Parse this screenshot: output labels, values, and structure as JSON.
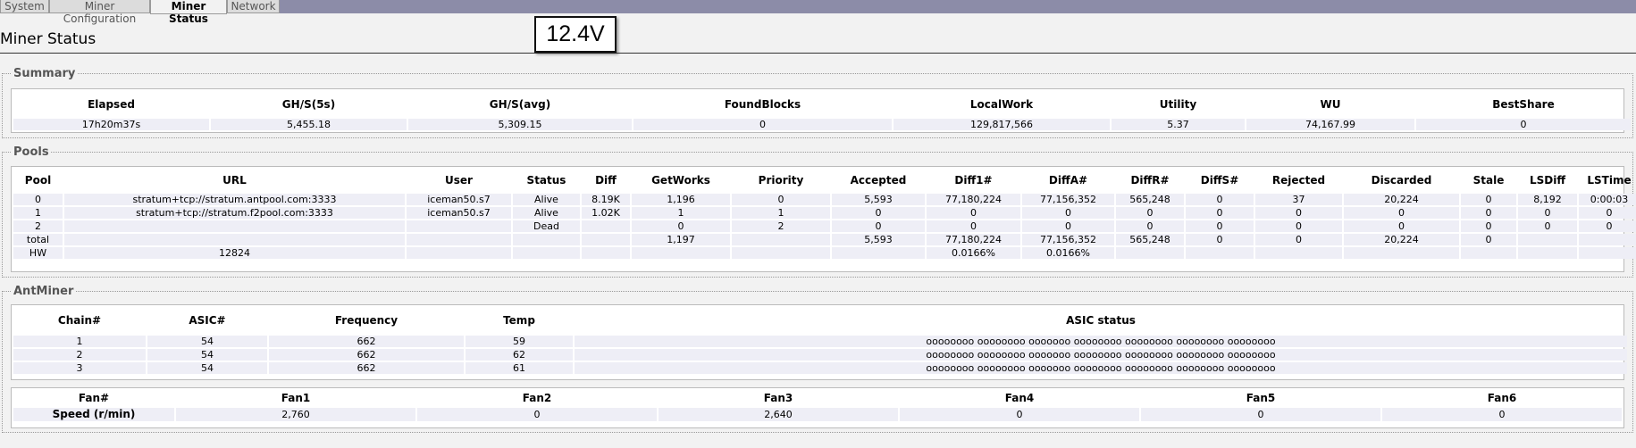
{
  "tabs": [
    {
      "label": "System"
    },
    {
      "label": "Miner Configuration"
    },
    {
      "label": "Miner Status",
      "active": true
    },
    {
      "label": "Network"
    }
  ],
  "page_title": "Miner Status",
  "voltage_overlay": "12.4V",
  "summary": {
    "legend": "Summary",
    "headers": [
      "Elapsed",
      "GH/S(5s)",
      "GH/S(avg)",
      "FoundBlocks",
      "LocalWork",
      "Utility",
      "WU",
      "BestShare"
    ],
    "row": [
      "17h20m37s",
      "5,455.18",
      "5,309.15",
      "0",
      "129,817,566",
      "5.37",
      "74,167.99",
      "0"
    ]
  },
  "pools": {
    "legend": "Pools",
    "headers": [
      "Pool",
      "URL",
      "User",
      "Status",
      "Diff",
      "GetWorks",
      "Priority",
      "Accepted",
      "Diff1#",
      "DiffA#",
      "DiffR#",
      "DiffS#",
      "Rejected",
      "Discarded",
      "Stale",
      "LSDiff",
      "LSTime"
    ],
    "rows": [
      [
        "0",
        "stratum+tcp://stratum.antpool.com:3333",
        "iceman50.s7",
        "Alive",
        "8.19K",
        "1,196",
        "0",
        "5,593",
        "77,180,224",
        "77,156,352",
        "565,248",
        "0",
        "37",
        "20,224",
        "0",
        "8,192",
        "0:00:03"
      ],
      [
        "1",
        "stratum+tcp://stratum.f2pool.com:3333",
        "iceman50.s7",
        "Alive",
        "1.02K",
        "1",
        "1",
        "0",
        "0",
        "0",
        "0",
        "0",
        "0",
        "0",
        "0",
        "0",
        "0"
      ],
      [
        "2",
        "",
        "",
        "Dead",
        "",
        "0",
        "2",
        "0",
        "0",
        "0",
        "0",
        "0",
        "0",
        "0",
        "0",
        "0",
        "0"
      ],
      [
        "total",
        "",
        "",
        "",
        "",
        "1,197",
        "",
        "5,593",
        "77,180,224",
        "77,156,352",
        "565,248",
        "0",
        "0",
        "20,224",
        "0",
        "",
        ""
      ],
      [
        "HW",
        "12824",
        "",
        "",
        "",
        "",
        "",
        "",
        "0.0166%",
        "0.0166%",
        "",
        "",
        "",
        "",
        "",
        "",
        ""
      ]
    ]
  },
  "antminer": {
    "legend": "AntMiner",
    "headers": [
      "Chain#",
      "ASIC#",
      "Frequency",
      "Temp",
      "ASIC status"
    ],
    "rows": [
      [
        "1",
        "54",
        "662",
        "59",
        "oooooooo oooooooo ooooooo oooooooo oooooooo oooooooo oooooooo"
      ],
      [
        "2",
        "54",
        "662",
        "62",
        "oooooooo oooooooo ooooooo oooooooo oooooooo oooooooo oooooooo"
      ],
      [
        "3",
        "54",
        "662",
        "61",
        "oooooooo oooooooo ooooooo oooooooo oooooooo oooooooo oooooooo"
      ]
    ]
  },
  "fans": {
    "headers": [
      "Fan#",
      "Fan1",
      "Fan2",
      "Fan3",
      "Fan4",
      "Fan5",
      "Fan6"
    ],
    "row": [
      "Speed (r/min)",
      "2,760",
      "0",
      "2,640",
      "0",
      "0",
      "0"
    ]
  }
}
